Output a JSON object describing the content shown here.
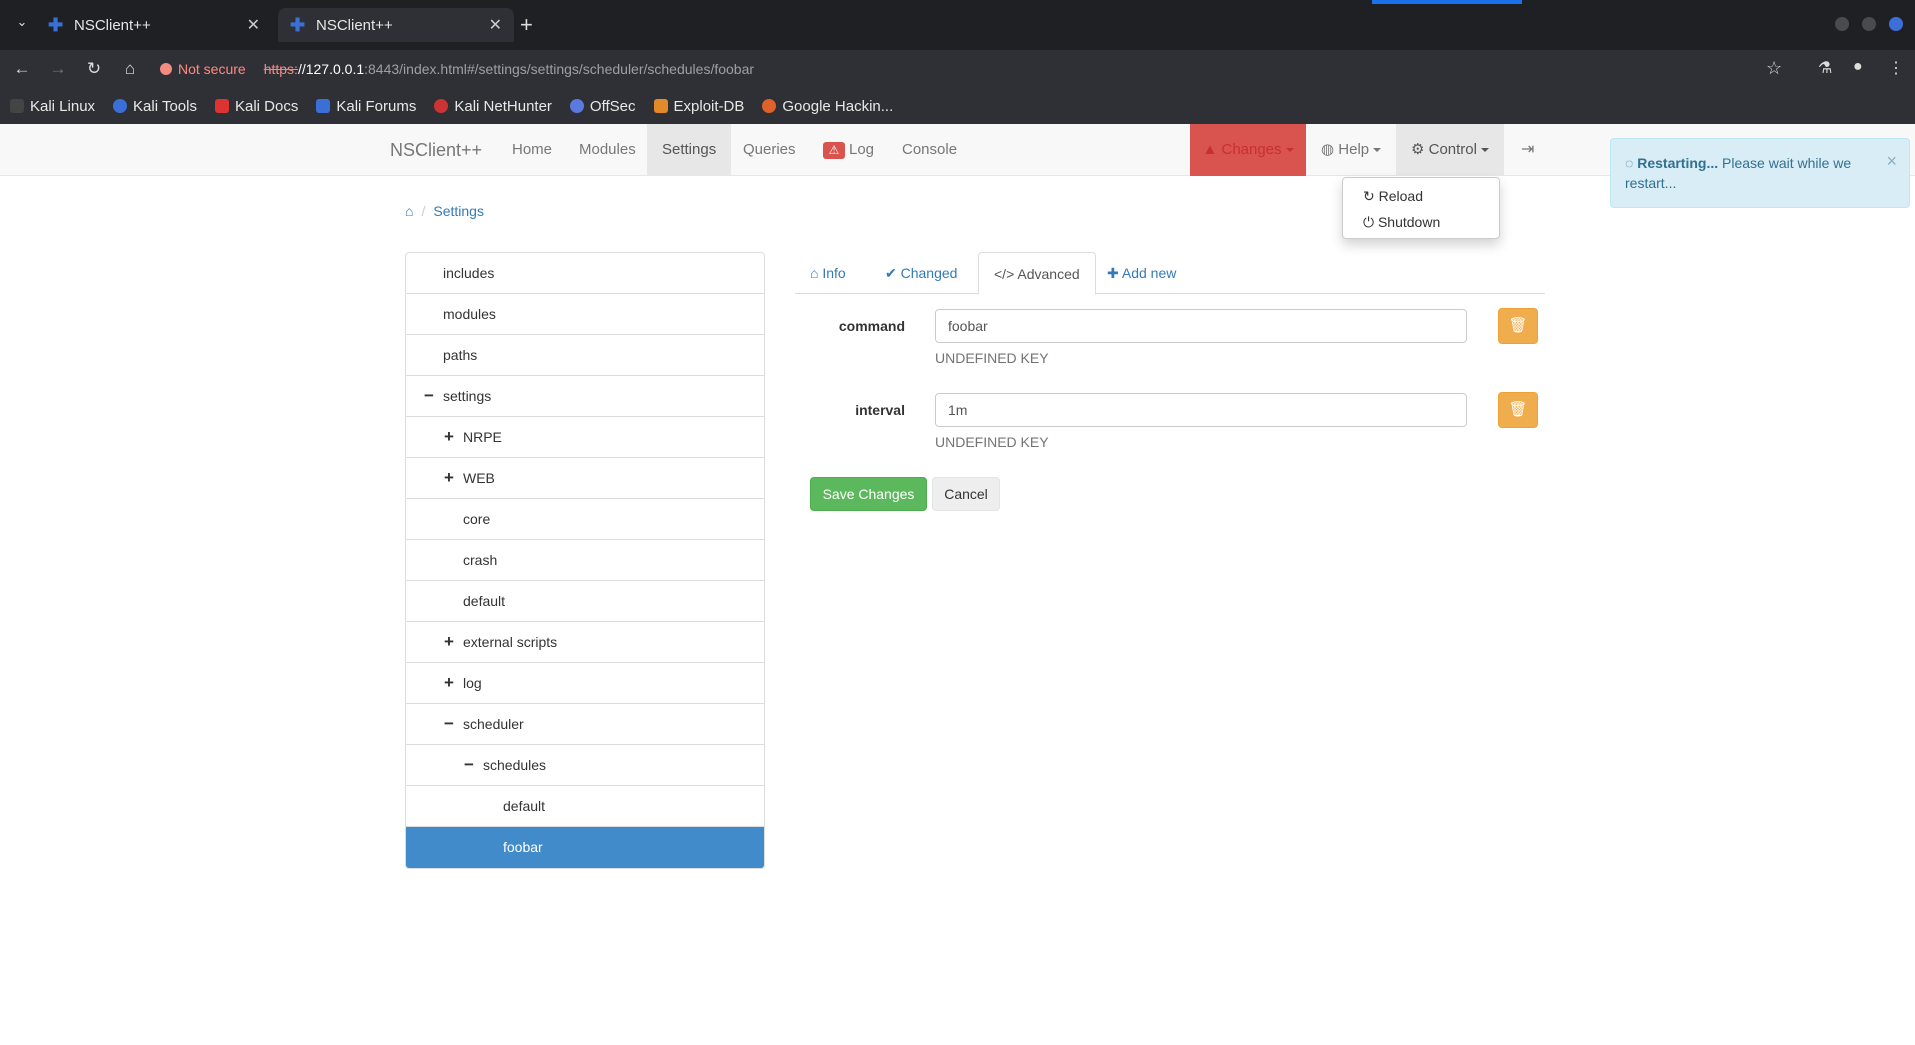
{
  "browser": {
    "tabs": [
      {
        "title": "NSClient++",
        "active": false
      },
      {
        "title": "NSClient++",
        "active": true
      }
    ],
    "security_label": "Not secure",
    "url_proto": "https:",
    "url_host": "//127.0.0.1",
    "url_path": ":8443/index.html#/settings/settings/scheduler/schedules/foobar",
    "bookmarks": [
      "Kali Linux",
      "Kali Tools",
      "Kali Docs",
      "Kali Forums",
      "Kali NetHunter",
      "OffSec",
      "Exploit-DB",
      "Google Hackin..."
    ]
  },
  "navbar": {
    "brand": "NSClient++",
    "items": [
      "Home",
      "Modules",
      "Settings",
      "Queries",
      "Log",
      "Console"
    ],
    "active": "Settings",
    "changes_label": "Changes",
    "help_label": "Help",
    "control_label": "Control"
  },
  "control_menu": {
    "reload": "Reload",
    "shutdown": "Shutdown"
  },
  "alert": {
    "strong": "Restarting...",
    "message": " Please wait while we restart..."
  },
  "breadcrumb": {
    "current": "Settings"
  },
  "tree": [
    {
      "label": "includes",
      "level": 0,
      "icon": ""
    },
    {
      "label": "modules",
      "level": 0,
      "icon": ""
    },
    {
      "label": "paths",
      "level": 0,
      "icon": ""
    },
    {
      "label": "settings",
      "level": 0,
      "icon": "minus"
    },
    {
      "label": "NRPE",
      "level": 1,
      "icon": "plus"
    },
    {
      "label": "WEB",
      "level": 1,
      "icon": "plus"
    },
    {
      "label": "core",
      "level": 1,
      "icon": ""
    },
    {
      "label": "crash",
      "level": 1,
      "icon": ""
    },
    {
      "label": "default",
      "level": 1,
      "icon": ""
    },
    {
      "label": "external scripts",
      "level": 1,
      "icon": "plus"
    },
    {
      "label": "log",
      "level": 1,
      "icon": "plus"
    },
    {
      "label": "scheduler",
      "level": 1,
      "icon": "minus"
    },
    {
      "label": "schedules",
      "level": 2,
      "icon": "minus"
    },
    {
      "label": "default",
      "level": 3,
      "icon": ""
    },
    {
      "label": "foobar",
      "level": 3,
      "icon": "",
      "selected": true
    }
  ],
  "tabs": {
    "info": "Info",
    "changed": "Changed",
    "advanced": "Advanced",
    "add_new": "Add new"
  },
  "form": {
    "command_label": "command",
    "command_value": "foobar",
    "command_help": "UNDEFINED KEY",
    "interval_label": "interval",
    "interval_value": "1m",
    "interval_help": "UNDEFINED KEY",
    "save_label": "Save Changes",
    "cancel_label": "Cancel"
  },
  "colors": {
    "primary": "#428bca",
    "success": "#5cb85c",
    "warning": "#f0ad4e",
    "danger": "#d9534f",
    "info_bg": "#d9edf7"
  }
}
